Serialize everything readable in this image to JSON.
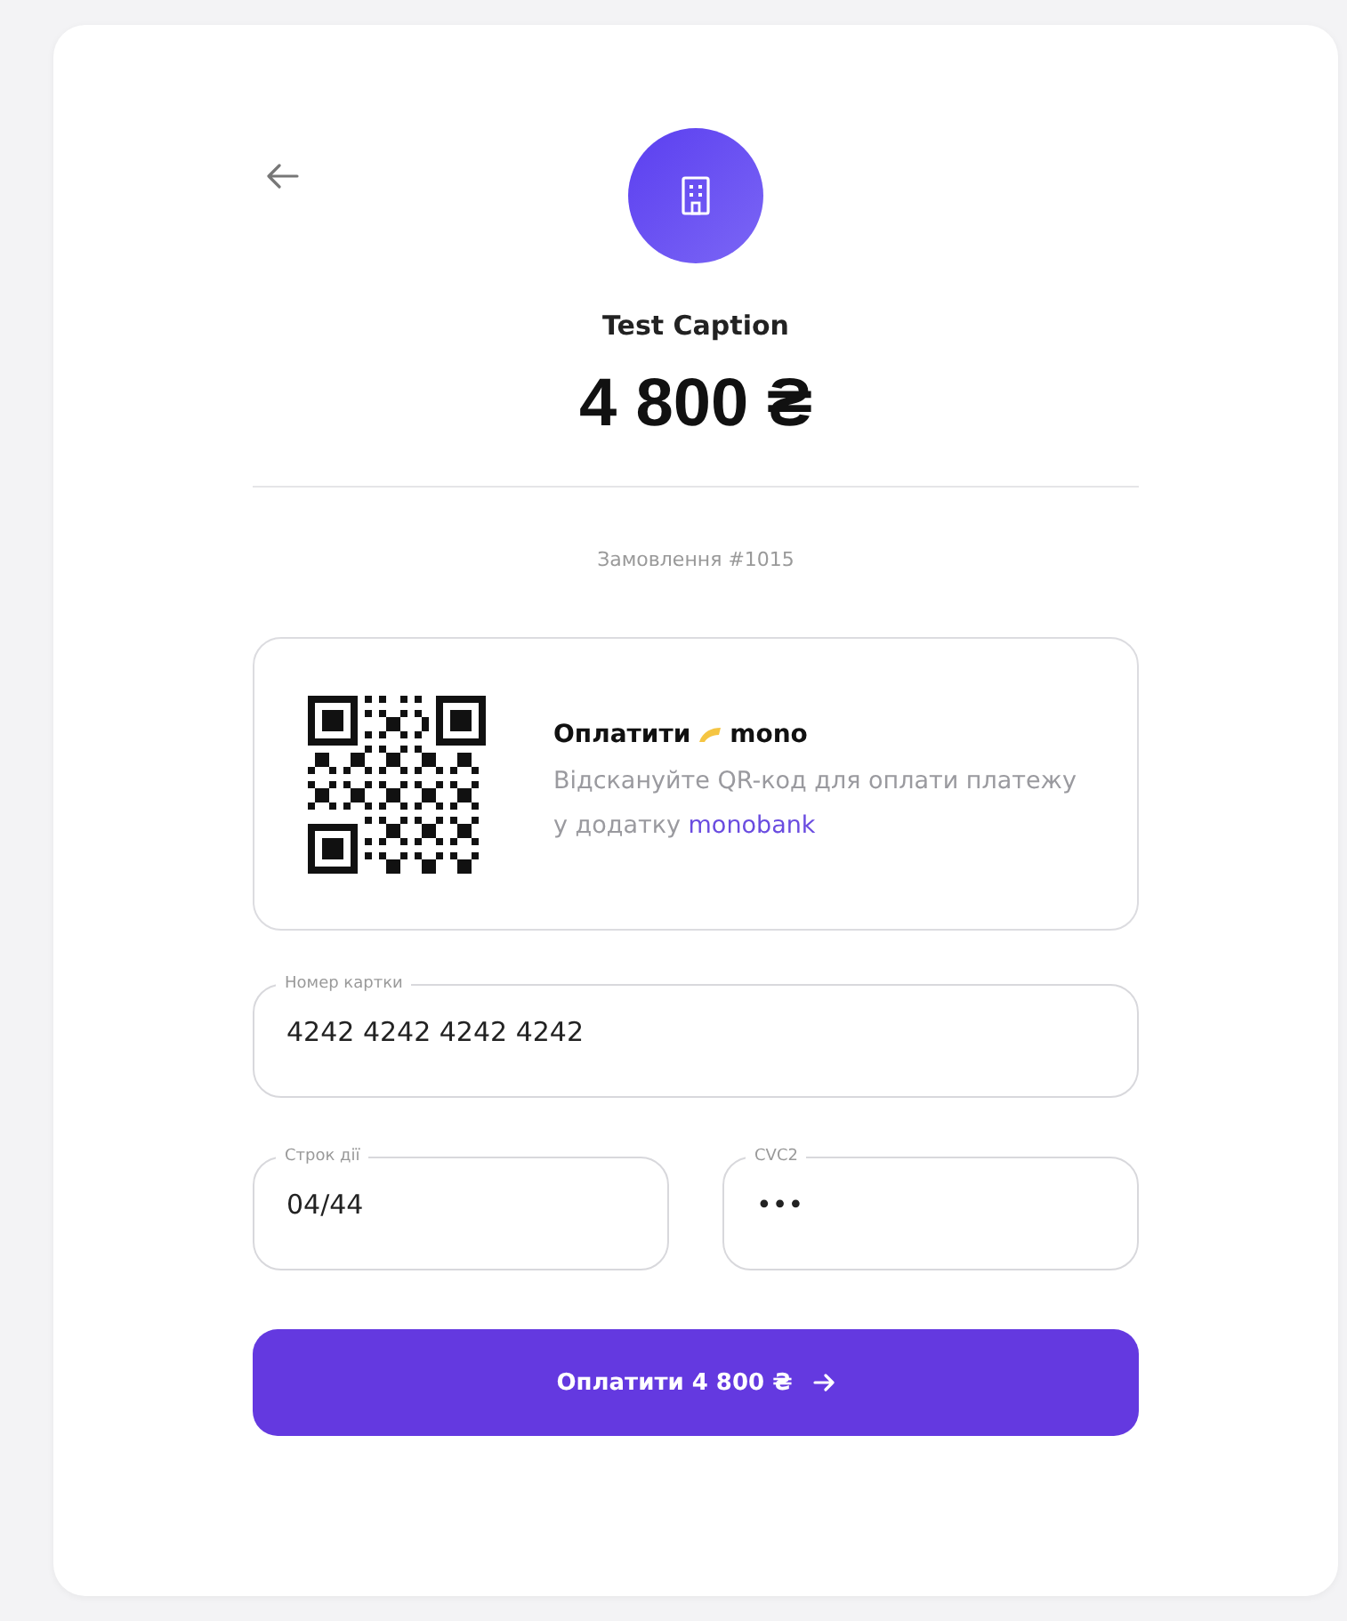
{
  "merchant": {
    "caption": "Test Caption",
    "amount": "4 800 ₴",
    "order": "Замовлення #1015"
  },
  "mono_pay": {
    "title": "Оплатити",
    "brand": "mono",
    "description": "Відскануйте QR-код для оплати платежу у додатку",
    "link": "monobank"
  },
  "fields": [
    {
      "label": "Номер картки",
      "value": "4242 4242 4242 4242"
    },
    {
      "label": "Строк дії",
      "value": "04/44"
    },
    {
      "label": "CVC2",
      "value": "•••"
    }
  ],
  "pay_button": {
    "label": "Оплатити 4 800 ₴"
  }
}
